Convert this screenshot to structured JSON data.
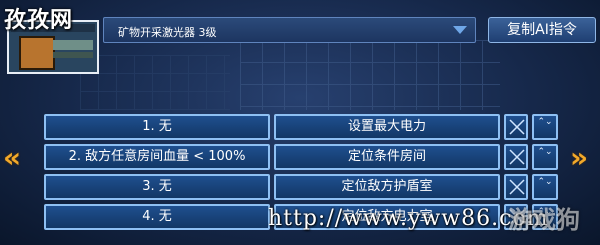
{
  "watermark": {
    "site_name": "孜孜网",
    "url": "http://www.yww86.com",
    "logo_text": "游戏狗"
  },
  "header": {
    "module_select": {
      "value": "矿物开采激光器 3级"
    },
    "copy_button_label": "复制AI指令"
  },
  "nav": {
    "left_arrow": "«",
    "right_arrow": "»"
  },
  "rows": [
    {
      "condition": "1. 无",
      "action": "设置最大电力"
    },
    {
      "condition": "2. 敌方任意房间血量 < 100%",
      "action": "定位条件房间"
    },
    {
      "condition": "3. 无",
      "action": "定位敌方护盾室"
    },
    {
      "condition": "4. 无",
      "action": "定位敌方电力室"
    }
  ],
  "row_controls": {
    "updown_symbol": "⌃⌄"
  },
  "colors": {
    "panel": "#1f4f8f",
    "border": "#8ec0f3",
    "accent_arrow": "#f2a92a",
    "caret": "#6fa7e8"
  }
}
